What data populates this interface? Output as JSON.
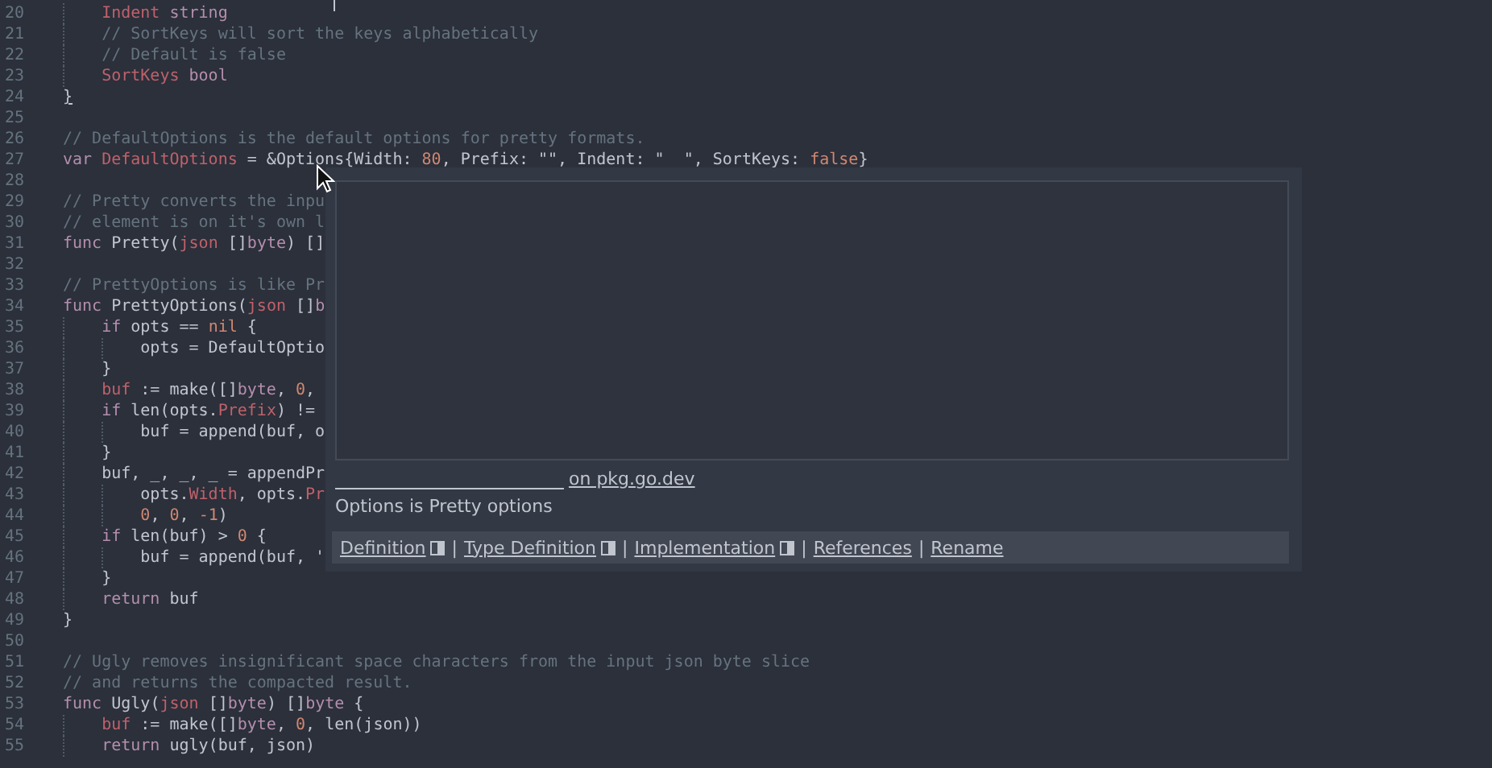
{
  "editor": {
    "lines": [
      {
        "number": "20",
        "tokens": [
          {
            "kind": "indent"
          },
          {
            "kind": "field",
            "text": "Indent"
          },
          {
            "kind": "type",
            "text": " string"
          }
        ]
      },
      {
        "number": "21",
        "tokens": [
          {
            "kind": "indent"
          },
          {
            "kind": "comment",
            "text": "// SortKeys will sort the keys alphabetically"
          }
        ]
      },
      {
        "number": "22",
        "tokens": [
          {
            "kind": "indent"
          },
          {
            "kind": "comment",
            "text": "// Default is false"
          }
        ]
      },
      {
        "number": "23",
        "tokens": [
          {
            "kind": "indent"
          },
          {
            "kind": "field",
            "text": "SortKeys"
          },
          {
            "kind": "type",
            "text": " bool"
          }
        ]
      },
      {
        "number": "24",
        "tokens": [
          {
            "kind": "bracket",
            "text": "}"
          }
        ]
      },
      {
        "number": "25"
      },
      {
        "number": "26",
        "tokens": [
          {
            "kind": "comment",
            "text": "// DefaultOptions is the default options for pretty formats."
          }
        ]
      },
      {
        "number": "27",
        "tokens": [
          {
            "kind": "keyword",
            "text": "var"
          },
          {
            "kind": "field",
            "text": " DefaultOptions"
          },
          {
            "kind": "plain",
            "text": " = &Options{Width: "
          },
          {
            "kind": "number",
            "text": "80"
          },
          {
            "kind": "plain",
            "text": ", Prefix: \"\", Indent: \"  \", SortKeys: "
          },
          {
            "kind": "number",
            "text": "false"
          },
          {
            "kind": "plain",
            "text": "}"
          }
        ]
      },
      {
        "number": "28"
      },
      {
        "number": "29",
        "tokens": [
          {
            "kind": "comment",
            "text": "// Pretty converts the inpu"
          }
        ]
      },
      {
        "number": "30",
        "tokens": [
          {
            "kind": "comment",
            "text": "// element is on it's own l"
          }
        ]
      },
      {
        "number": "31",
        "tokens": [
          {
            "kind": "keyword",
            "text": "func"
          },
          {
            "kind": "plain",
            "text": " Pretty("
          },
          {
            "kind": "field",
            "text": "json"
          },
          {
            "kind": "plain",
            "text": " []"
          },
          {
            "kind": "type",
            "text": "byte"
          },
          {
            "kind": "plain",
            "text": ") []"
          }
        ]
      },
      {
        "number": "32"
      },
      {
        "number": "33",
        "tokens": [
          {
            "kind": "comment",
            "text": "// PrettyOptions is like Pr"
          }
        ]
      },
      {
        "number": "34",
        "tokens": [
          {
            "kind": "keyword",
            "text": "func"
          },
          {
            "kind": "plain",
            "text": " PrettyOptions("
          },
          {
            "kind": "field",
            "text": "json"
          },
          {
            "kind": "plain",
            "text": " []"
          },
          {
            "kind": "type",
            "text": "b"
          }
        ]
      },
      {
        "number": "35",
        "tokens": [
          {
            "kind": "indent"
          },
          {
            "kind": "keyword",
            "text": "if"
          },
          {
            "kind": "plain",
            "text": " opts == "
          },
          {
            "kind": "number",
            "text": "nil"
          },
          {
            "kind": "plain",
            "text": " {"
          }
        ]
      },
      {
        "number": "36",
        "tokens": [
          {
            "kind": "indent"
          },
          {
            "kind": "indent"
          },
          {
            "kind": "plain",
            "text": "opts = DefaultOptio"
          }
        ]
      },
      {
        "number": "37",
        "tokens": [
          {
            "kind": "indent"
          },
          {
            "kind": "plain",
            "text": "}"
          }
        ]
      },
      {
        "number": "38",
        "tokens": [
          {
            "kind": "indent"
          },
          {
            "kind": "field",
            "text": "buf"
          },
          {
            "kind": "plain",
            "text": " := make([]"
          },
          {
            "kind": "type",
            "text": "byte"
          },
          {
            "kind": "plain",
            "text": ", "
          },
          {
            "kind": "number",
            "text": "0"
          },
          {
            "kind": "plain",
            "text": ","
          }
        ]
      },
      {
        "number": "39",
        "tokens": [
          {
            "kind": "indent"
          },
          {
            "kind": "keyword",
            "text": "if"
          },
          {
            "kind": "plain",
            "text": " len(opts."
          },
          {
            "kind": "field",
            "text": "Prefix"
          },
          {
            "kind": "plain",
            "text": ") !="
          }
        ]
      },
      {
        "number": "40",
        "tokens": [
          {
            "kind": "indent"
          },
          {
            "kind": "indent"
          },
          {
            "kind": "plain",
            "text": "buf = append(buf, o"
          }
        ]
      },
      {
        "number": "41",
        "tokens": [
          {
            "kind": "indent"
          },
          {
            "kind": "plain",
            "text": "}"
          }
        ]
      },
      {
        "number": "42",
        "tokens": [
          {
            "kind": "indent"
          },
          {
            "kind": "plain",
            "text": "buf, _, _, _ = appendPr"
          }
        ]
      },
      {
        "number": "43",
        "tokens": [
          {
            "kind": "indent"
          },
          {
            "kind": "indent"
          },
          {
            "kind": "plain",
            "text": "opts."
          },
          {
            "kind": "field",
            "text": "Width"
          },
          {
            "kind": "plain",
            "text": ", opts."
          },
          {
            "kind": "field",
            "text": "Pr"
          }
        ]
      },
      {
        "number": "44",
        "tokens": [
          {
            "kind": "indent"
          },
          {
            "kind": "indent"
          },
          {
            "kind": "number",
            "text": "0"
          },
          {
            "kind": "plain",
            "text": ", "
          },
          {
            "kind": "number",
            "text": "0"
          },
          {
            "kind": "plain",
            "text": ", "
          },
          {
            "kind": "number",
            "text": "-1"
          },
          {
            "kind": "plain",
            "text": ")"
          }
        ]
      },
      {
        "number": "45",
        "tokens": [
          {
            "kind": "indent"
          },
          {
            "kind": "keyword",
            "text": "if"
          },
          {
            "kind": "plain",
            "text": " len(buf) > "
          },
          {
            "kind": "number",
            "text": "0"
          },
          {
            "kind": "plain",
            "text": " {"
          }
        ]
      },
      {
        "number": "46",
        "tokens": [
          {
            "kind": "indent"
          },
          {
            "kind": "indent"
          },
          {
            "kind": "plain",
            "text": "buf = append(buf, '"
          }
        ]
      },
      {
        "number": "47",
        "tokens": [
          {
            "kind": "indent"
          },
          {
            "kind": "plain",
            "text": "}"
          }
        ]
      },
      {
        "number": "48",
        "tokens": [
          {
            "kind": "indent"
          },
          {
            "kind": "keyword",
            "text": "return"
          },
          {
            "kind": "plain",
            "text": " buf"
          }
        ]
      },
      {
        "number": "49",
        "tokens": [
          {
            "kind": "plain",
            "text": "}"
          }
        ]
      },
      {
        "number": "50"
      },
      {
        "number": "51",
        "tokens": [
          {
            "kind": "comment",
            "text": "// Ugly removes insignificant space characters from the input json byte slice"
          }
        ]
      },
      {
        "number": "52",
        "tokens": [
          {
            "kind": "comment",
            "text": "// and returns the compacted result."
          }
        ]
      },
      {
        "number": "53",
        "tokens": [
          {
            "kind": "keyword",
            "text": "func"
          },
          {
            "kind": "plain",
            "text": " Ugly("
          },
          {
            "kind": "field",
            "text": "json"
          },
          {
            "kind": "plain",
            "text": " []"
          },
          {
            "kind": "type",
            "text": "byte"
          },
          {
            "kind": "plain",
            "text": ") []"
          },
          {
            "kind": "type",
            "text": "byte"
          },
          {
            "kind": "plain",
            "text": " {"
          }
        ]
      },
      {
        "number": "54",
        "tokens": [
          {
            "kind": "indent"
          },
          {
            "kind": "field",
            "text": "buf"
          },
          {
            "kind": "plain",
            "text": " := make([]"
          },
          {
            "kind": "type",
            "text": "byte"
          },
          {
            "kind": "plain",
            "text": ", "
          },
          {
            "kind": "number",
            "text": "0"
          },
          {
            "kind": "plain",
            "text": ", len(json))"
          }
        ]
      },
      {
        "number": "55",
        "tokens": [
          {
            "kind": "indent"
          },
          {
            "kind": "keyword",
            "text": "return"
          },
          {
            "kind": "plain",
            "text": " ugly(buf, json)"
          }
        ]
      }
    ]
  },
  "hover_popup": {
    "doc_link": "on pkg.go.dev",
    "summary": "Options is Pretty options",
    "actions": [
      {
        "label": "Definition",
        "opens_side": true,
        "separator": "|"
      },
      {
        "label": "Type Definition",
        "opens_side": true,
        "separator": "|"
      },
      {
        "label": "Implementation",
        "opens_side": true,
        "separator": "|"
      },
      {
        "label": "References",
        "opens_side": false,
        "separator": "|"
      },
      {
        "label": "Rename",
        "opens_side": false
      }
    ]
  }
}
